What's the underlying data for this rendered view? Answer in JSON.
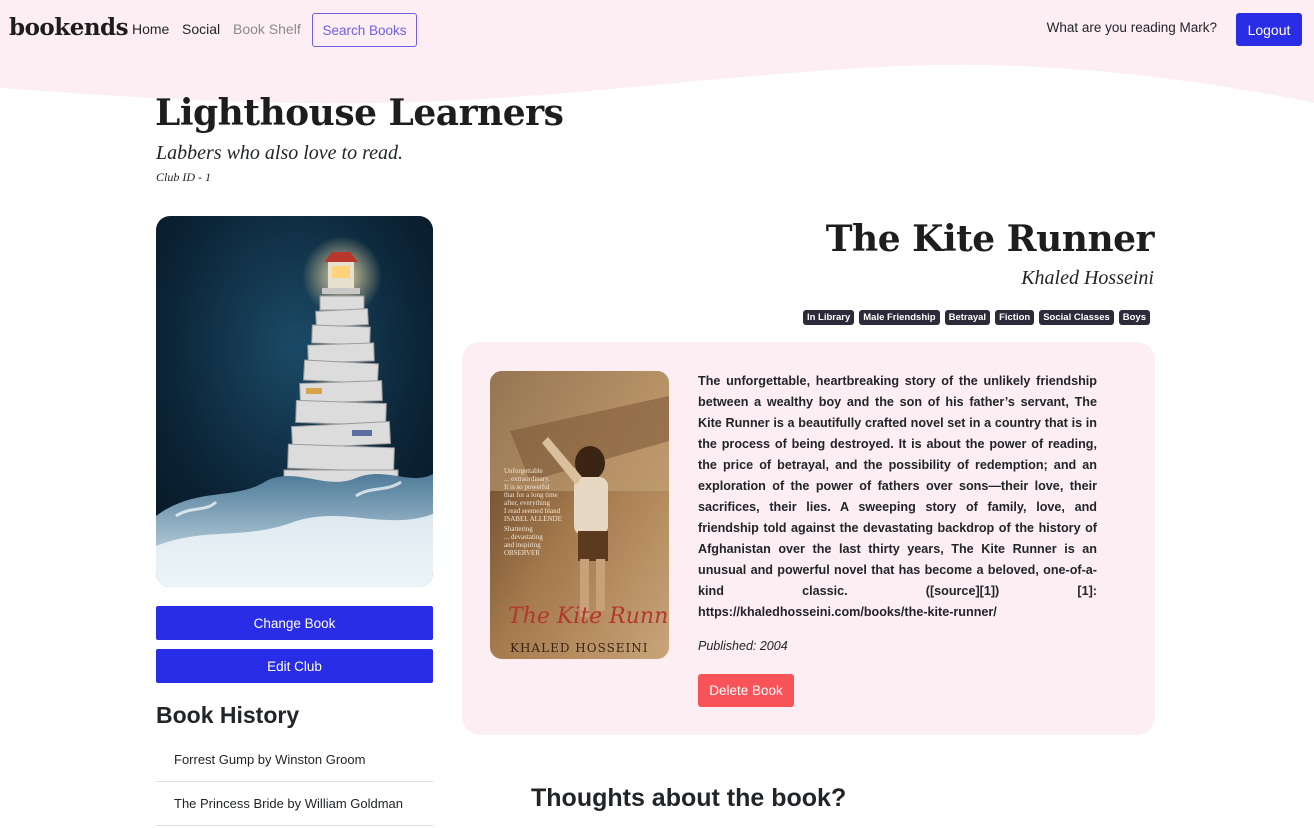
{
  "colors": {
    "accent": "#2a2de6",
    "header_pink": "#fdeef3",
    "danger": "#f9535a",
    "tag_bg": "#2b2b3a",
    "search_outline": "#6f5fe0"
  },
  "navbar": {
    "brand": "bookends",
    "links": [
      {
        "label": "Home"
      },
      {
        "label": "Social"
      },
      {
        "label": "Book Shelf"
      }
    ],
    "search_label": "Search Books",
    "greeting": "What are you reading Mark?",
    "logout_label": "Logout"
  },
  "club": {
    "name": "Lighthouse Learners",
    "tagline": "Labbers who also love to read.",
    "id_label": "Club ID - 1",
    "change_book_label": "Change Book",
    "edit_club_label": "Edit Club"
  },
  "history": {
    "title": "Book History",
    "items": [
      "Forrest Gump by Winston Groom",
      "The Princess Bride by William Goldman"
    ]
  },
  "book": {
    "title": "The Kite Runner",
    "author": "Khaled Hosseini",
    "tags": [
      "In Library",
      "Male Friendship",
      "Betrayal",
      "Fiction",
      "Social Classes",
      "Boys"
    ],
    "description": "The unforgettable, heartbreaking story of the unlikely friendship between a wealthy boy and the son of his father’s servant, The Kite Runner is a beautifully crafted novel set in a country that is in the process of being destroyed. It is about the power of reading, the price of betrayal, and the possibility of redemption; and an exploration of the power of fathers over sons—their love, their sacrifices, their lies. A sweeping story of family, love, and friendship told against the devastating backdrop of the history of Afghanistan over the last thirty years, The Kite Runner is an unusual and powerful novel that has become a beloved, one-of-a-kind classic. ([source][1]) [1]: https://khaledhosseini.com/books/the-kite-runner/",
    "published": "Published: 2004",
    "delete_label": "Delete Book",
    "cover": {
      "title_script": "The Kite Runner",
      "author_caps": "KHALED HOSSEINI",
      "blurb_1": [
        "Unforgettable",
        "... extraordinary.",
        "It is so powerful",
        "that for a long time",
        "after, everything",
        "I read seemed bland",
        "ISABEL ALLENDE"
      ],
      "blurb_2": [
        "Shattering",
        "... devastating",
        "and inspiring",
        "OBSERVER"
      ]
    }
  },
  "thoughts_heading": "Thoughts about the book?"
}
